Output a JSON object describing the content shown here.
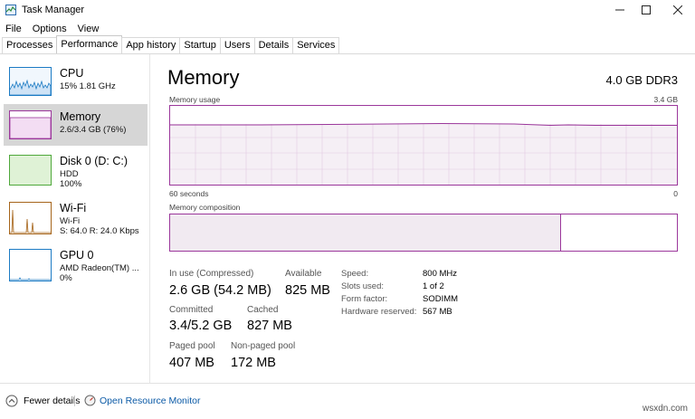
{
  "window": {
    "title": "Task Manager"
  },
  "menu": [
    "File",
    "Options",
    "View"
  ],
  "tabs": [
    "Processes",
    "Performance",
    "App history",
    "Startup",
    "Users",
    "Details",
    "Services"
  ],
  "active_tab": "Performance",
  "sidebar": [
    {
      "id": "cpu",
      "title": "CPU",
      "lines": [
        "15% 1.81 GHz"
      ],
      "color": "#1c7bc4"
    },
    {
      "id": "memory",
      "title": "Memory",
      "lines": [
        "2.6/3.4 GB (76%)"
      ],
      "color": "#9b379b",
      "selected": true
    },
    {
      "id": "disk",
      "title": "Disk 0 (D: C:)",
      "lines": [
        "HDD",
        "100%"
      ],
      "color": "#4fa83b"
    },
    {
      "id": "wifi",
      "title": "Wi-Fi",
      "lines": [
        "Wi-Fi",
        "S: 64.0  R: 24.0 Kbps"
      ],
      "color": "#a6651b"
    },
    {
      "id": "gpu",
      "title": "GPU 0",
      "lines": [
        "AMD Radeon(TM) ...",
        "0%"
      ],
      "color": "#1c7bc4"
    }
  ],
  "main": {
    "title": "Memory",
    "spec": "4.0 GB DDR3",
    "usage_label": "Memory usage",
    "usage_max": "3.4 GB",
    "time_left": "60 seconds",
    "time_right": "0",
    "usage_level": 0.76,
    "composition_label": "Memory composition",
    "composition_in_use_fraction": 0.76,
    "stats": {
      "in_use_label": "In use (Compressed)",
      "in_use_value": "2.6 GB (54.2 MB)",
      "available_label": "Available",
      "available_value": "825 MB",
      "committed_label": "Committed",
      "committed_value": "3.4/5.2 GB",
      "cached_label": "Cached",
      "cached_value": "827 MB",
      "paged_label": "Paged pool",
      "paged_value": "407 MB",
      "nonpaged_label": "Non-paged pool",
      "nonpaged_value": "172 MB"
    },
    "details": [
      {
        "label": "Speed:",
        "value": "800 MHz"
      },
      {
        "label": "Slots used:",
        "value": "1 of 2"
      },
      {
        "label": "Form factor:",
        "value": "SODIMM"
      },
      {
        "label": "Hardware reserved:",
        "value": "567 MB"
      }
    ]
  },
  "footer": {
    "fewer_details": "Fewer details",
    "resource_monitor": "Open Resource Monitor"
  },
  "watermark": "wsxdn.com"
}
